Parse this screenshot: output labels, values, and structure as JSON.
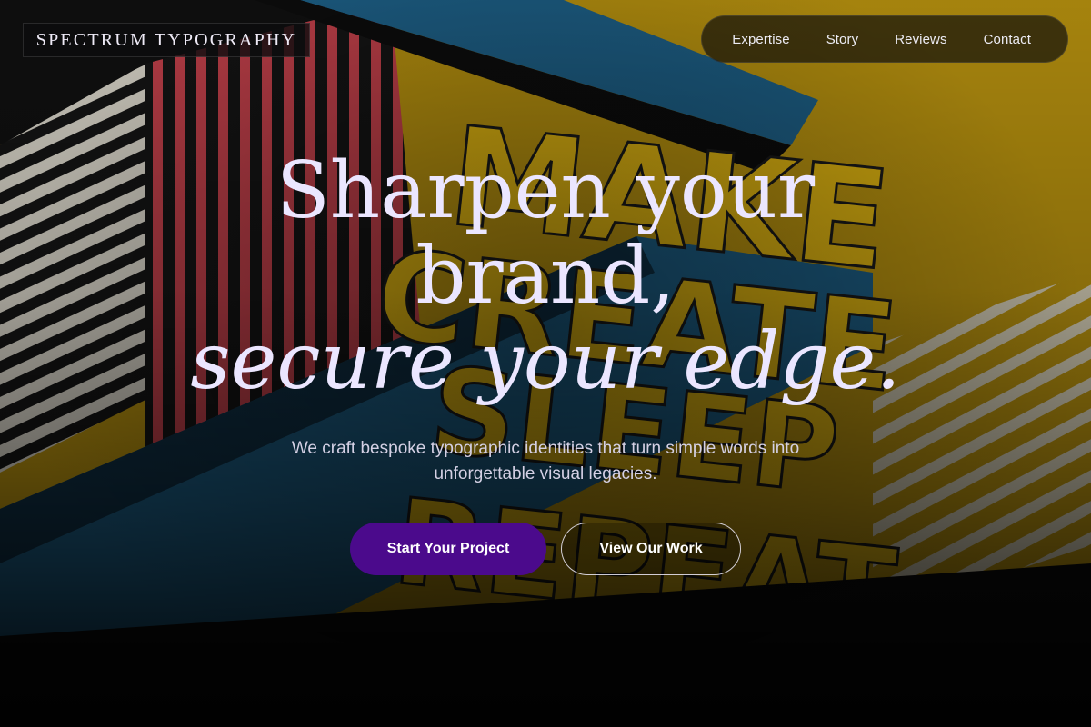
{
  "brand": {
    "name": "SPECTRUM TYPOGRAPHY"
  },
  "nav": {
    "items": [
      {
        "label": "Expertise"
      },
      {
        "label": "Story"
      },
      {
        "label": "Reviews"
      },
      {
        "label": "Contact"
      }
    ]
  },
  "hero": {
    "title_line_1": "Sharpen your",
    "title_line_2": "brand,",
    "title_line_3": "secure your edge.",
    "subtitle": "We craft bespoke typographic identities that turn simple words into unforgettable visual legacies.",
    "primary_cta": "Start Your Project",
    "secondary_cta": "View Our Work"
  },
  "background": {
    "poster_words": [
      "MAKE",
      "CREATE",
      "SLEEP",
      "REPEAT"
    ],
    "colors": {
      "mustard": "#b8920f",
      "teal": "#1d5f86",
      "red": "#c2404a",
      "black": "#101010"
    }
  },
  "colors": {
    "accent": "#4b0a8c",
    "heading": "#ebe6ff"
  }
}
